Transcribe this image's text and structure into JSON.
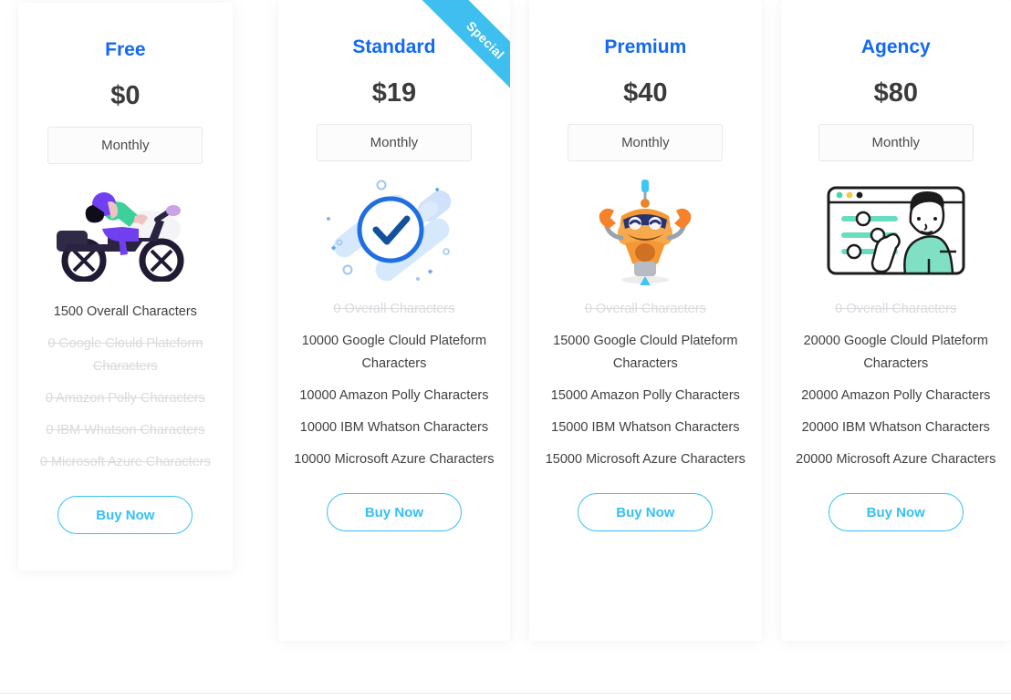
{
  "theme": {
    "plan_name_color": "#1269f3",
    "price_color": "#3b3b3b",
    "accent_button_color": "#35c0f5",
    "ribbon_color": "#3fbff0",
    "disabled_feature_color": "#d8dadd",
    "card_background": "#ffffff",
    "page_background": "#ffffff"
  },
  "plans": [
    {
      "name": "Free",
      "price": "$0",
      "billing": "Monthly",
      "ribbon": null,
      "illustration": "scooter-rider-illustration",
      "features": [
        {
          "text": "1500 Overall Characters",
          "enabled": true
        },
        {
          "text": "0 Google Clould Plateform Characters",
          "enabled": false
        },
        {
          "text": "0 Amazon Polly Characters",
          "enabled": false
        },
        {
          "text": "0 IBM Whatson Characters",
          "enabled": false
        },
        {
          "text": "0 Microsoft Azure Characters",
          "enabled": false
        }
      ],
      "cta": "Buy Now"
    },
    {
      "name": "Standard",
      "price": "$19",
      "billing": "Monthly",
      "ribbon": "Special",
      "illustration": "check-circle-illustration",
      "features": [
        {
          "text": "0 Overall Characters",
          "enabled": false
        },
        {
          "text": "10000 Google Clould Plateform Characters",
          "enabled": true
        },
        {
          "text": "10000 Amazon Polly Characters",
          "enabled": true
        },
        {
          "text": "10000 IBM Whatson Characters",
          "enabled": true
        },
        {
          "text": "10000 Microsoft Azure Characters",
          "enabled": true
        }
      ],
      "cta": "Buy Now"
    },
    {
      "name": "Premium",
      "price": "$40",
      "billing": "Monthly",
      "ribbon": null,
      "illustration": "robot-illustration",
      "features": [
        {
          "text": "0 Overall Characters",
          "enabled": false
        },
        {
          "text": "15000 Google Clould Plateform Characters",
          "enabled": true
        },
        {
          "text": "15000 Amazon Polly Characters",
          "enabled": true
        },
        {
          "text": "15000 IBM Whatson Characters",
          "enabled": true
        },
        {
          "text": "15000 Microsoft Azure Characters",
          "enabled": true
        }
      ],
      "cta": "Buy Now"
    },
    {
      "name": "Agency",
      "price": "$80",
      "billing": "Monthly",
      "ribbon": null,
      "illustration": "person-settings-window-illustration",
      "features": [
        {
          "text": "0 Overall Characters",
          "enabled": false
        },
        {
          "text": "20000 Google Clould Plateform Characters",
          "enabled": true
        },
        {
          "text": "20000 Amazon Polly Characters",
          "enabled": true
        },
        {
          "text": "20000 IBM Whatson Characters",
          "enabled": true
        },
        {
          "text": "20000 Microsoft Azure Characters",
          "enabled": true
        }
      ],
      "cta": "Buy Now"
    }
  ]
}
